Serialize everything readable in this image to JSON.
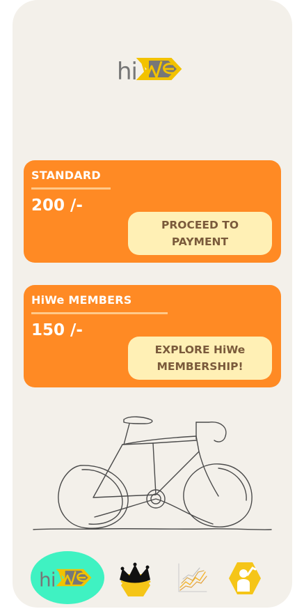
{
  "app": {
    "logo_text": "hiWe",
    "logo_brand_colors": {
      "hi": "#777777",
      "we_hex": "#f2c200",
      "we_letters": "#666666"
    }
  },
  "plans": [
    {
      "name": "STANDARD",
      "price": "200 /-",
      "cta_label": "PROCEED TO PAYMENT"
    },
    {
      "name": "HiWe MEMBERS",
      "price": "150 /-",
      "cta_label": "EXPLORE HiWe MEMBERSHIP!"
    }
  ],
  "illustration": {
    "icon": "bicycle-line-art-icon"
  },
  "bottom_nav": [
    {
      "icon": "hiwe-home-logo-icon",
      "active": true
    },
    {
      "icon": "crown-hexagon-icon",
      "active": false
    },
    {
      "icon": "growth-chart-icon",
      "active": false
    },
    {
      "icon": "profile-hexagon-icon",
      "active": false
    }
  ],
  "colors": {
    "background": "#f3f0ea",
    "card": "#ff8a24",
    "cta": "#fff0b5",
    "cta_text": "#7a5a3b",
    "active_nav": "#3ff2c2",
    "accent_yellow": "#f5c518"
  }
}
